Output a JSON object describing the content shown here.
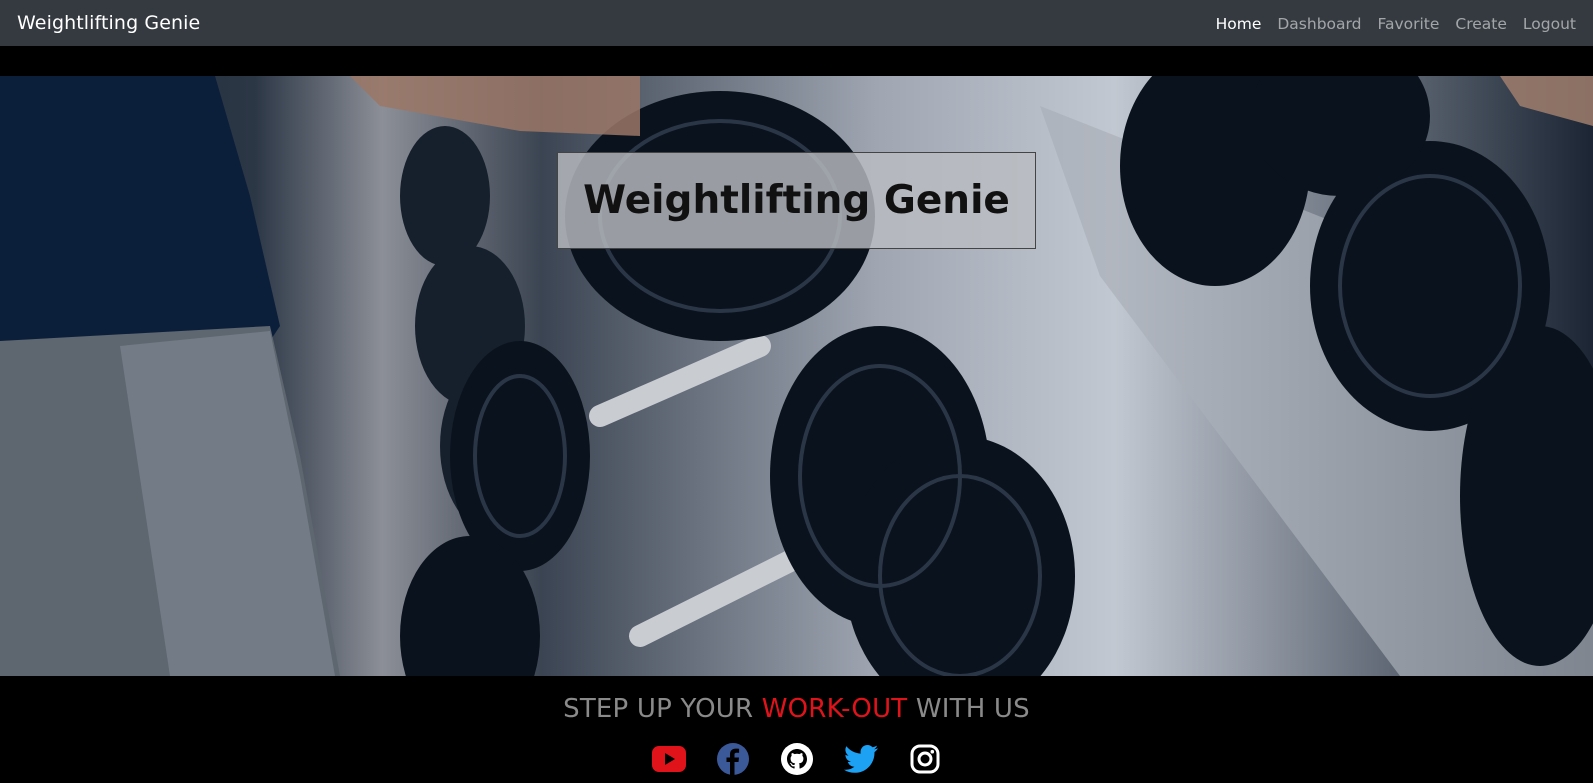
{
  "navbar": {
    "brand": "Weightlifting Genie",
    "links": [
      {
        "label": "Home"
      },
      {
        "label": "Dashboard"
      },
      {
        "label": "Favorite"
      },
      {
        "label": "Create"
      },
      {
        "label": "Logout"
      }
    ]
  },
  "hero": {
    "title": "Weightlifting Genie"
  },
  "footer": {
    "tagline_start": "STEP UP YOUR",
    "tagline_accent": "WORK-OUT",
    "tagline_end": "WITH US",
    "accent_color": "#e0131b",
    "social_icons": [
      "youtube-icon",
      "facebook-icon",
      "github-icon",
      "twitter-icon",
      "instagram-icon"
    ]
  }
}
